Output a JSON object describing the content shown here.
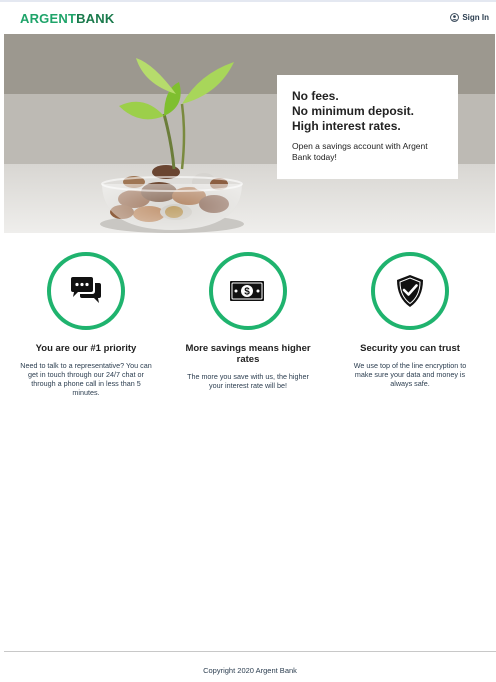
{
  "header": {
    "logo_part1": "ARGENT",
    "logo_part2": "BANK",
    "sign_in_label": "Sign In"
  },
  "hero": {
    "headline_lines": [
      "No fees.",
      "No minimum deposit.",
      "High interest rates."
    ],
    "subtext": "Open a savings account with Argent Bank today!"
  },
  "features": [
    {
      "icon": "chat-icon",
      "title": "You are our #1 priority",
      "text": "Need to talk to a representative? You can get in touch through our 24/7 chat or through a phone call in less than 5 minutes."
    },
    {
      "icon": "money-icon",
      "title": "More savings means higher rates",
      "text": "The more you save with us, the higher your interest rate will be!"
    },
    {
      "icon": "security-icon",
      "title": "Security you can trust",
      "text": "We use top of the line encryption to make sure your data and money is always safe."
    }
  ],
  "footer": {
    "copyright": "Copyright 2020 Argent Bank"
  },
  "colors": {
    "brand_green": "#1fb36e",
    "text_dark": "#2c3e50"
  }
}
